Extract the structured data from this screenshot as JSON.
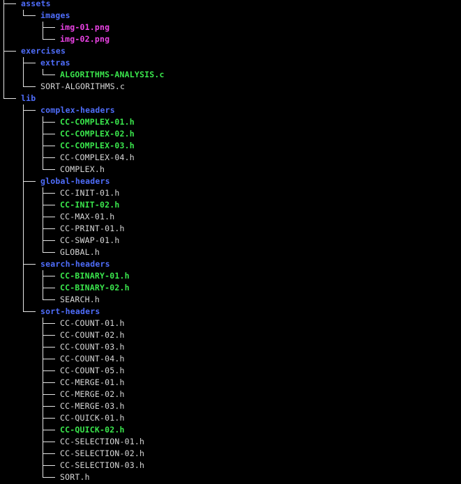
{
  "tree": [
    {
      "depth": 1,
      "name": "assets",
      "kind": "dir",
      "last": false
    },
    {
      "depth": 2,
      "name": "images",
      "kind": "dir",
      "last": true
    },
    {
      "depth": 3,
      "name": "img-01.png",
      "kind": "image",
      "last": false
    },
    {
      "depth": 3,
      "name": "img-02.png",
      "kind": "image",
      "last": true
    },
    {
      "depth": 1,
      "name": "exercises",
      "kind": "dir",
      "last": false
    },
    {
      "depth": 2,
      "name": "extras",
      "kind": "dir",
      "last": false
    },
    {
      "depth": 3,
      "name": "ALGORITHMS-ANALYSIS.c",
      "kind": "exec",
      "last": true
    },
    {
      "depth": 2,
      "name": "SORT-ALGORITHMS.c",
      "kind": "file",
      "last": true
    },
    {
      "depth": 1,
      "name": "lib",
      "kind": "dir",
      "last": true
    },
    {
      "depth": 2,
      "name": "complex-headers",
      "kind": "dir",
      "last": false
    },
    {
      "depth": 3,
      "name": "CC-COMPLEX-01.h",
      "kind": "exec",
      "last": false
    },
    {
      "depth": 3,
      "name": "CC-COMPLEX-02.h",
      "kind": "exec",
      "last": false
    },
    {
      "depth": 3,
      "name": "CC-COMPLEX-03.h",
      "kind": "exec",
      "last": false
    },
    {
      "depth": 3,
      "name": "CC-COMPLEX-04.h",
      "kind": "file",
      "last": false
    },
    {
      "depth": 3,
      "name": "COMPLEX.h",
      "kind": "file",
      "last": true
    },
    {
      "depth": 2,
      "name": "global-headers",
      "kind": "dir",
      "last": false
    },
    {
      "depth": 3,
      "name": "CC-INIT-01.h",
      "kind": "file",
      "last": false
    },
    {
      "depth": 3,
      "name": "CC-INIT-02.h",
      "kind": "exec",
      "last": false
    },
    {
      "depth": 3,
      "name": "CC-MAX-01.h",
      "kind": "file",
      "last": false
    },
    {
      "depth": 3,
      "name": "CC-PRINT-01.h",
      "kind": "file",
      "last": false
    },
    {
      "depth": 3,
      "name": "CC-SWAP-01.h",
      "kind": "file",
      "last": false
    },
    {
      "depth": 3,
      "name": "GLOBAL.h",
      "kind": "file",
      "last": true
    },
    {
      "depth": 2,
      "name": "search-headers",
      "kind": "dir",
      "last": false
    },
    {
      "depth": 3,
      "name": "CC-BINARY-01.h",
      "kind": "exec",
      "last": false
    },
    {
      "depth": 3,
      "name": "CC-BINARY-02.h",
      "kind": "exec",
      "last": false
    },
    {
      "depth": 3,
      "name": "SEARCH.h",
      "kind": "file",
      "last": true
    },
    {
      "depth": 2,
      "name": "sort-headers",
      "kind": "dir",
      "last": true
    },
    {
      "depth": 3,
      "name": "CC-COUNT-01.h",
      "kind": "file",
      "last": false
    },
    {
      "depth": 3,
      "name": "CC-COUNT-02.h",
      "kind": "file",
      "last": false
    },
    {
      "depth": 3,
      "name": "CC-COUNT-03.h",
      "kind": "file",
      "last": false
    },
    {
      "depth": 3,
      "name": "CC-COUNT-04.h",
      "kind": "file",
      "last": false
    },
    {
      "depth": 3,
      "name": "CC-COUNT-05.h",
      "kind": "file",
      "last": false
    },
    {
      "depth": 3,
      "name": "CC-MERGE-01.h",
      "kind": "file",
      "last": false
    },
    {
      "depth": 3,
      "name": "CC-MERGE-02.h",
      "kind": "file",
      "last": false
    },
    {
      "depth": 3,
      "name": "CC-MERGE-03.h",
      "kind": "file",
      "last": false
    },
    {
      "depth": 3,
      "name": "CC-QUICK-01.h",
      "kind": "file",
      "last": false
    },
    {
      "depth": 3,
      "name": "CC-QUICK-02.h",
      "kind": "exec",
      "last": false
    },
    {
      "depth": 3,
      "name": "CC-SELECTION-01.h",
      "kind": "file",
      "last": false
    },
    {
      "depth": 3,
      "name": "CC-SELECTION-02.h",
      "kind": "file",
      "last": false
    },
    {
      "depth": 3,
      "name": "CC-SELECTION-03.h",
      "kind": "file",
      "last": false
    },
    {
      "depth": 3,
      "name": "SORT.h",
      "kind": "file",
      "last": true
    }
  ],
  "colors": {
    "background": "#000000",
    "directory": "#4f6dfa",
    "executable": "#3ae54c",
    "image": "#ec43e6",
    "regular_file": "#d8d8d8",
    "tree_lines": "#e6e6e6"
  }
}
